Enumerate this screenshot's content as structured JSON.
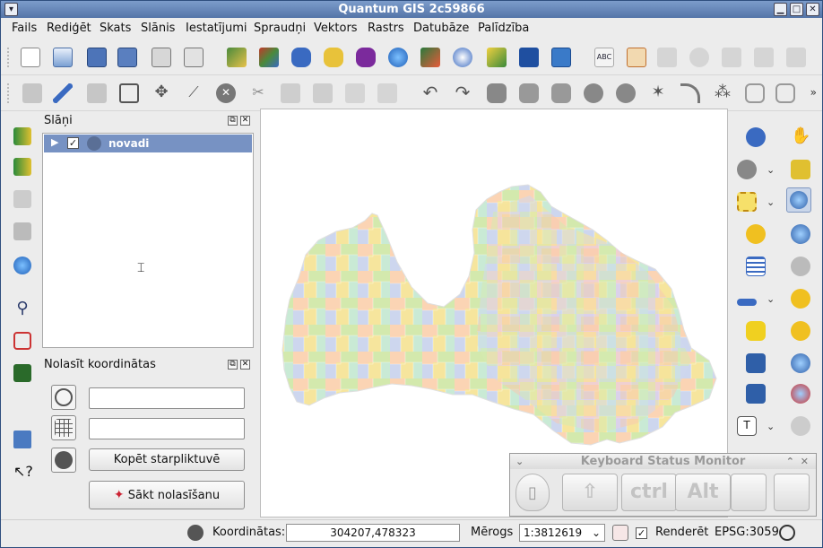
{
  "window": {
    "title": "Quantum GIS 2c59866",
    "controls": [
      "minimize-icon",
      "maximize-icon",
      "close-icon"
    ]
  },
  "menubar": {
    "items": [
      {
        "label": "Fails"
      },
      {
        "label": "Rediģēt"
      },
      {
        "label": "Skats"
      },
      {
        "label": "Slānis"
      },
      {
        "label": "Iestatījumi"
      },
      {
        "label": "Spraudņi"
      },
      {
        "label": "Vektors"
      },
      {
        "label": "Rastrs"
      },
      {
        "label": "Datubāze"
      },
      {
        "label": "Palīdzība"
      }
    ]
  },
  "toolbar1": {
    "icons": [
      "new-project-icon",
      "open-project-icon",
      "save-project-icon",
      "save-as-icon",
      "print-composer-icon",
      "print-icon",
      "add-vector-layer-icon",
      "add-raster-layer-icon",
      "add-postgis-layer-icon",
      "add-spatialite-layer-icon",
      "add-mssql-layer-icon",
      "add-wms-layer-icon",
      "add-wfs-layer-icon",
      "new-shapefile-icon",
      "remove-layer-icon",
      "add-delimited-text-icon",
      "label-abc-icon",
      "label-move-icon",
      "label-rotate-icon",
      "label-show-icon",
      "label-pin-icon",
      "label-change-icon",
      "label-highlight-icon"
    ]
  },
  "toolbar2": {
    "icons": [
      "save-edits-icon",
      "toggle-editing-icon",
      "save-layer-icon",
      "add-feature-icon",
      "move-feature-icon",
      "node-tool-icon",
      "delete-selected-icon",
      "cut-features-icon",
      "copy-features-icon",
      "paste-features-icon",
      "split-features-icon",
      "split-parts-icon",
      "undo-icon",
      "redo-icon",
      "simplify-icon",
      "add-ring-icon",
      "add-part-icon",
      "delete-ring-icon",
      "delete-part-icon",
      "reshape-icon",
      "offset-curve-icon",
      "rotate-point-icon",
      "merge-features-icon",
      "merge-attributes-icon",
      "fill-ring-icon"
    ]
  },
  "left_strip": {
    "icons": [
      "histogram-stretch-icon",
      "local-stretch-icon",
      "increase-brightness-icon",
      "decrease-brightness-icon",
      "georeferencer-icon",
      "measure-tool-icon",
      "gps-tools-icon",
      "grass-tools-icon",
      "bookmark-icon",
      "whats-this-icon"
    ]
  },
  "layers_panel": {
    "title": "Slāņi",
    "layers": [
      {
        "name": "novadi",
        "checked": true
      }
    ]
  },
  "coord_panel": {
    "title": "Nolasīt koordinātas",
    "field1_value": "",
    "field2_value": "",
    "copy_button": "Kopēt starpliktuvē",
    "start_button": "Sākt nolasīšanu"
  },
  "right_tools": {
    "icons": [
      "identify-icon",
      "pan-icon",
      "select-features-icon",
      "pan-to-selection-icon",
      "select-by-rectangle-icon",
      "zoom-in-icon",
      "deselect-icon",
      "zoom-out-icon",
      "attribute-table-icon",
      "zoom-full-icon",
      "measure-line-icon",
      "zoom-to-layer-icon",
      "map-tips-icon",
      "zoom-to-selection-icon",
      "new-bookmark-icon",
      "zoom-last-icon",
      "show-bookmarks-icon",
      "zoom-next-icon",
      "text-annotation-icon",
      "zoom-actual-size-icon"
    ]
  },
  "keyboard_monitor": {
    "title": "Keyboard Status Monitor",
    "keys": [
      "",
      "ctrl",
      "Alt",
      "",
      ""
    ]
  },
  "statusbar": {
    "coord_label": "Koordinātas:",
    "coord_value": "304207,478323",
    "scale_label": "Mērogs",
    "scale_value": "1:3812619",
    "render_label": "Renderēt",
    "render_checked": true,
    "crs": "EPSG:3059"
  },
  "colors": {
    "titlebar": "#5f80b3",
    "selection": "#7792c3",
    "map_colors": [
      "#f7c6d7",
      "#fbd2b0",
      "#d0e8a8",
      "#cfd6ec",
      "#f6e49a",
      "#c9ead5",
      "#e6cbe8",
      "#f4cbb1"
    ]
  }
}
